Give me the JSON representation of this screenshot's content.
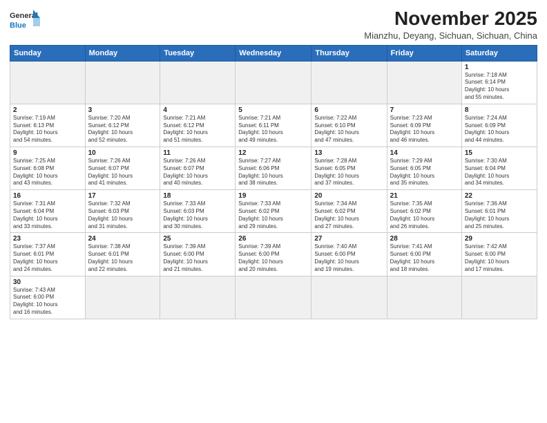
{
  "logo": {
    "line1": "General",
    "line2": "Blue"
  },
  "title": "November 2025",
  "subtitle": "Mianzhu, Deyang, Sichuan, Sichuan, China",
  "days_of_week": [
    "Sunday",
    "Monday",
    "Tuesday",
    "Wednesday",
    "Thursday",
    "Friday",
    "Saturday"
  ],
  "weeks": [
    [
      {
        "day": "",
        "info": ""
      },
      {
        "day": "",
        "info": ""
      },
      {
        "day": "",
        "info": ""
      },
      {
        "day": "",
        "info": ""
      },
      {
        "day": "",
        "info": ""
      },
      {
        "day": "",
        "info": ""
      },
      {
        "day": "1",
        "info": "Sunrise: 7:18 AM\nSunset: 6:14 PM\nDaylight: 10 hours\nand 55 minutes."
      }
    ],
    [
      {
        "day": "2",
        "info": "Sunrise: 7:19 AM\nSunset: 6:13 PM\nDaylight: 10 hours\nand 54 minutes."
      },
      {
        "day": "3",
        "info": "Sunrise: 7:20 AM\nSunset: 6:12 PM\nDaylight: 10 hours\nand 52 minutes."
      },
      {
        "day": "4",
        "info": "Sunrise: 7:21 AM\nSunset: 6:12 PM\nDaylight: 10 hours\nand 51 minutes."
      },
      {
        "day": "5",
        "info": "Sunrise: 7:21 AM\nSunset: 6:11 PM\nDaylight: 10 hours\nand 49 minutes."
      },
      {
        "day": "6",
        "info": "Sunrise: 7:22 AM\nSunset: 6:10 PM\nDaylight: 10 hours\nand 47 minutes."
      },
      {
        "day": "7",
        "info": "Sunrise: 7:23 AM\nSunset: 6:09 PM\nDaylight: 10 hours\nand 46 minutes."
      },
      {
        "day": "8",
        "info": "Sunrise: 7:24 AM\nSunset: 6:09 PM\nDaylight: 10 hours\nand 44 minutes."
      }
    ],
    [
      {
        "day": "9",
        "info": "Sunrise: 7:25 AM\nSunset: 6:08 PM\nDaylight: 10 hours\nand 43 minutes."
      },
      {
        "day": "10",
        "info": "Sunrise: 7:26 AM\nSunset: 6:07 PM\nDaylight: 10 hours\nand 41 minutes."
      },
      {
        "day": "11",
        "info": "Sunrise: 7:26 AM\nSunset: 6:07 PM\nDaylight: 10 hours\nand 40 minutes."
      },
      {
        "day": "12",
        "info": "Sunrise: 7:27 AM\nSunset: 6:06 PM\nDaylight: 10 hours\nand 38 minutes."
      },
      {
        "day": "13",
        "info": "Sunrise: 7:28 AM\nSunset: 6:05 PM\nDaylight: 10 hours\nand 37 minutes."
      },
      {
        "day": "14",
        "info": "Sunrise: 7:29 AM\nSunset: 6:05 PM\nDaylight: 10 hours\nand 35 minutes."
      },
      {
        "day": "15",
        "info": "Sunrise: 7:30 AM\nSunset: 6:04 PM\nDaylight: 10 hours\nand 34 minutes."
      }
    ],
    [
      {
        "day": "16",
        "info": "Sunrise: 7:31 AM\nSunset: 6:04 PM\nDaylight: 10 hours\nand 33 minutes."
      },
      {
        "day": "17",
        "info": "Sunrise: 7:32 AM\nSunset: 6:03 PM\nDaylight: 10 hours\nand 31 minutes."
      },
      {
        "day": "18",
        "info": "Sunrise: 7:33 AM\nSunset: 6:03 PM\nDaylight: 10 hours\nand 30 minutes."
      },
      {
        "day": "19",
        "info": "Sunrise: 7:33 AM\nSunset: 6:02 PM\nDaylight: 10 hours\nand 29 minutes."
      },
      {
        "day": "20",
        "info": "Sunrise: 7:34 AM\nSunset: 6:02 PM\nDaylight: 10 hours\nand 27 minutes."
      },
      {
        "day": "21",
        "info": "Sunrise: 7:35 AM\nSunset: 6:02 PM\nDaylight: 10 hours\nand 26 minutes."
      },
      {
        "day": "22",
        "info": "Sunrise: 7:36 AM\nSunset: 6:01 PM\nDaylight: 10 hours\nand 25 minutes."
      }
    ],
    [
      {
        "day": "23",
        "info": "Sunrise: 7:37 AM\nSunset: 6:01 PM\nDaylight: 10 hours\nand 24 minutes."
      },
      {
        "day": "24",
        "info": "Sunrise: 7:38 AM\nSunset: 6:01 PM\nDaylight: 10 hours\nand 22 minutes."
      },
      {
        "day": "25",
        "info": "Sunrise: 7:39 AM\nSunset: 6:00 PM\nDaylight: 10 hours\nand 21 minutes."
      },
      {
        "day": "26",
        "info": "Sunrise: 7:39 AM\nSunset: 6:00 PM\nDaylight: 10 hours\nand 20 minutes."
      },
      {
        "day": "27",
        "info": "Sunrise: 7:40 AM\nSunset: 6:00 PM\nDaylight: 10 hours\nand 19 minutes."
      },
      {
        "day": "28",
        "info": "Sunrise: 7:41 AM\nSunset: 6:00 PM\nDaylight: 10 hours\nand 18 minutes."
      },
      {
        "day": "29",
        "info": "Sunrise: 7:42 AM\nSunset: 6:00 PM\nDaylight: 10 hours\nand 17 minutes."
      }
    ],
    [
      {
        "day": "30",
        "info": "Sunrise: 7:43 AM\nSunset: 6:00 PM\nDaylight: 10 hours\nand 16 minutes."
      },
      {
        "day": "",
        "info": ""
      },
      {
        "day": "",
        "info": ""
      },
      {
        "day": "",
        "info": ""
      },
      {
        "day": "",
        "info": ""
      },
      {
        "day": "",
        "info": ""
      },
      {
        "day": "",
        "info": ""
      }
    ]
  ]
}
